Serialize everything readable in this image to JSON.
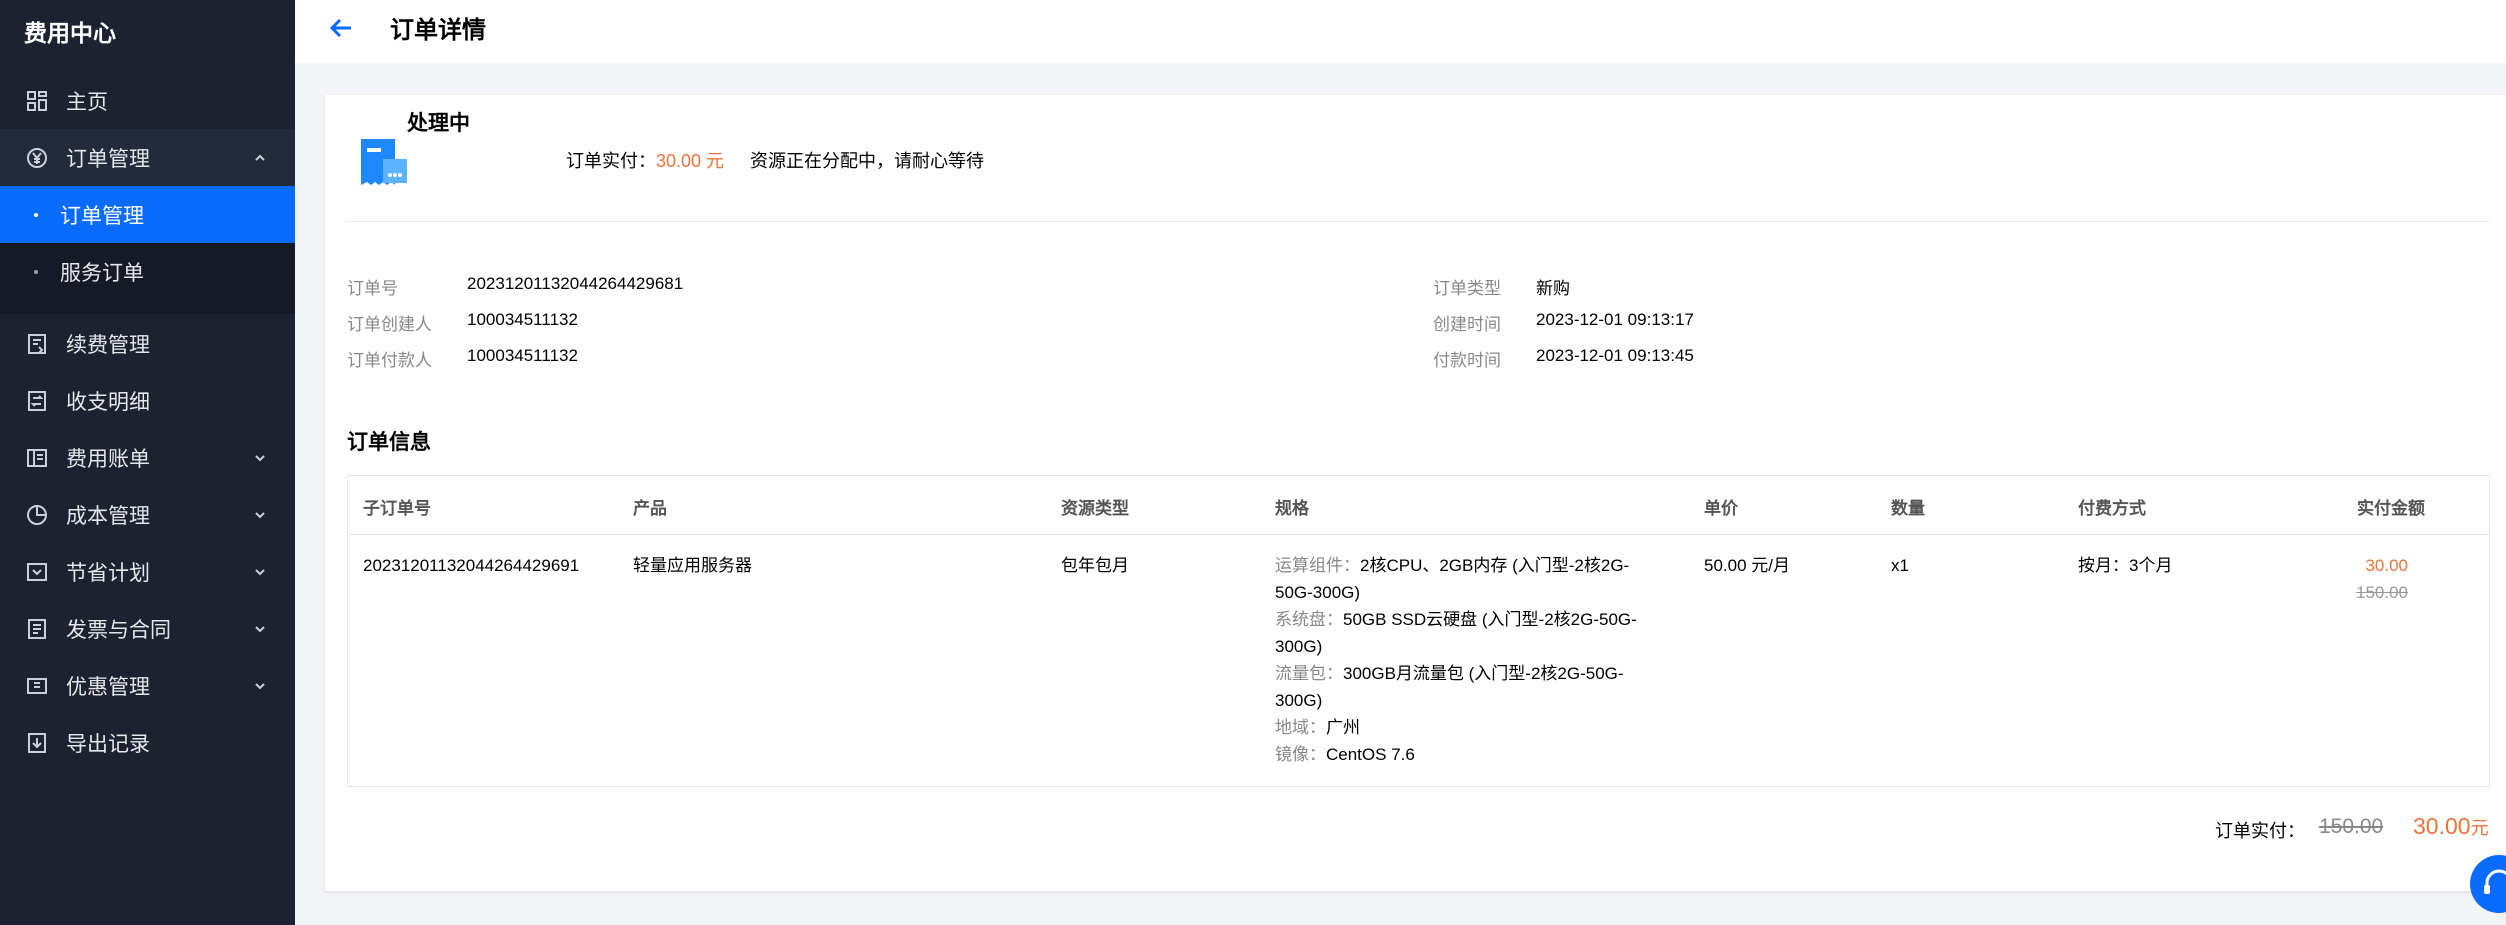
{
  "sidebar": {
    "title": "费用中心",
    "items": [
      {
        "label": "主页"
      },
      {
        "label": "订单管理"
      },
      {
        "label": "订单管理"
      },
      {
        "label": "服务订单"
      },
      {
        "label": "续费管理"
      },
      {
        "label": "收支明细"
      },
      {
        "label": "费用账单"
      },
      {
        "label": "成本管理"
      },
      {
        "label": "节省计划"
      },
      {
        "label": "发票与合同"
      },
      {
        "label": "优惠管理"
      },
      {
        "label": "导出记录"
      }
    ]
  },
  "header": {
    "title": "订单详情"
  },
  "status": {
    "text": "处理中",
    "paid_label": "订单实付：",
    "paid_value": "30.00 元",
    "note": "资源正在分配中，请耐心等待"
  },
  "info": {
    "order_no_label": "订单号",
    "order_no": "20231201132044264429681",
    "creator_label": "订单创建人",
    "creator": "100034511132",
    "payer_label": "订单付款人",
    "payer": "100034511132",
    "type_label": "订单类型",
    "type": "新购",
    "created_label": "创建时间",
    "created": "2023-12-01 09:13:17",
    "paid_time_label": "付款时间",
    "paid_time": "2023-12-01 09:13:45"
  },
  "section_title": "订单信息",
  "table": {
    "headers": [
      "子订单号",
      "产品",
      "资源类型",
      "规格",
      "单价",
      "数量",
      "付费方式",
      "实付金额"
    ],
    "row": {
      "sub_order_no": "20231201132044264429691",
      "product": "轻量应用服务器",
      "resource_type": "包年包月",
      "spec": [
        {
          "k": "运算组件：",
          "v": "2核CPU、2GB内存 (入门型-2核2G-",
          "v2": "50G-300G)"
        },
        {
          "k": "系统盘：",
          "v": "50GB SSD云硬盘 (入门型-2核2G-50G-",
          "v2": "300G)"
        },
        {
          "k": "流量包：",
          "v": "300GB月流量包 (入门型-2核2G-50G-",
          "v2": "300G)"
        },
        {
          "k": "地域：",
          "v": "广州"
        },
        {
          "k": "镜像：",
          "v": "CentOS 7.6"
        }
      ],
      "unit_price": "50.00 元/月",
      "quantity": "x1",
      "billing": "按月：3个月",
      "paid": "30.00",
      "original": "150.00"
    }
  },
  "total": {
    "label": "订单实付：",
    "original": "150.00",
    "paid": "30.00",
    "unit": "元"
  },
  "colors": {
    "accent": "#0a6cff",
    "price": "#e8743b",
    "sidebar": "#1c2230"
  }
}
